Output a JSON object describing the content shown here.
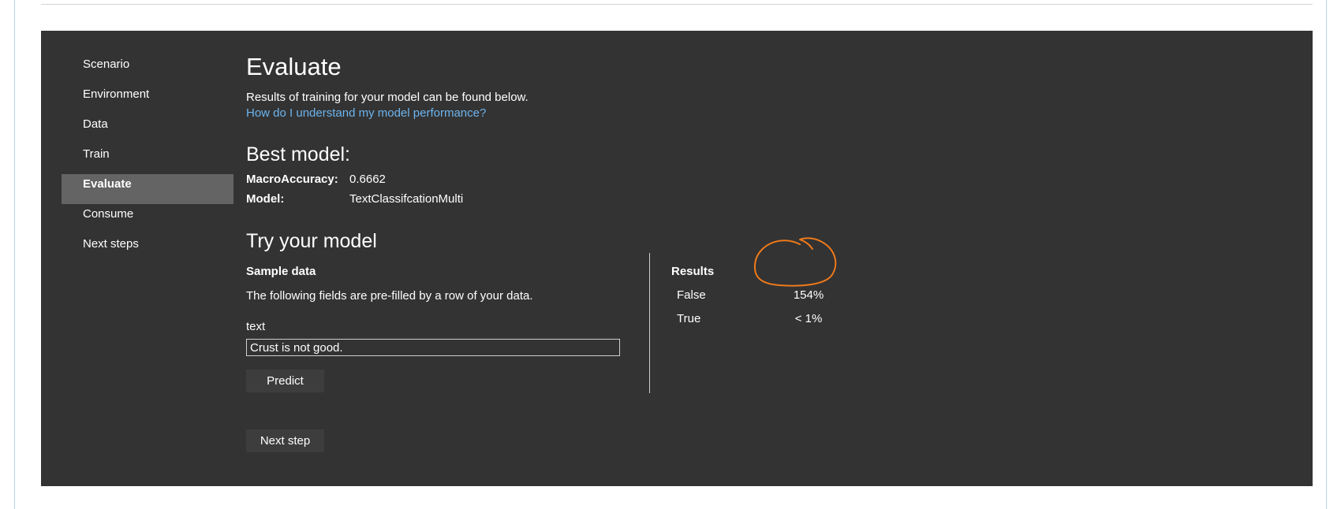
{
  "nav": {
    "items": [
      "Scenario",
      "Environment",
      "Data",
      "Train",
      "Evaluate",
      "Consume",
      "Next steps"
    ],
    "active": "Evaluate"
  },
  "evaluate": {
    "title": "Evaluate",
    "description": "Results of training for your model can be found below.",
    "help_link": "How do I understand my model performance?"
  },
  "best_model": {
    "title": "Best model:",
    "metric_label": "MacroAccuracy:",
    "metric_value": "0.6662",
    "model_label": "Model:",
    "model_value": "TextClassifcationMulti"
  },
  "try_model": {
    "title": "Try your model",
    "sample_title": "Sample data",
    "sample_note": "The following fields are pre-filled by a row of your data.",
    "field_label": "text",
    "field_value": "Crust is not good.",
    "predict_label": "Predict"
  },
  "results": {
    "title": "Results",
    "rows": [
      {
        "label": "False",
        "value": "154%"
      },
      {
        "label": "True",
        "value": "< 1%"
      }
    ]
  },
  "footer": {
    "next_label": "Next step"
  },
  "colors": {
    "panel_bg": "#333333",
    "nav_active_bg": "#646464",
    "link": "#6cb4ee",
    "annotation": "#f07a1a",
    "frame": "#b9d3ee"
  }
}
